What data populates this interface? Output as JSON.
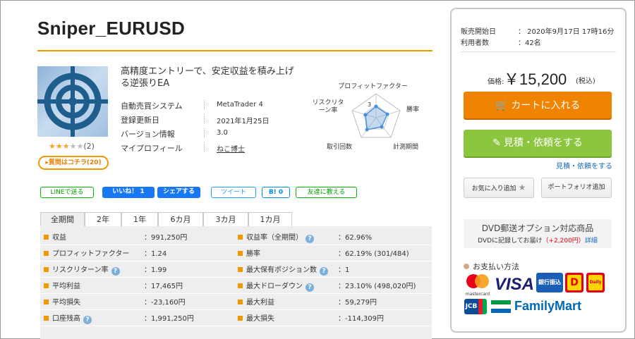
{
  "product": {
    "title": "Sniper_EURUSD",
    "tagline": "高精度エントリーで、安定収益を積み上げる逆張りEA",
    "rating_count": "(2)",
    "rating_value": 3,
    "rating_max": 5,
    "question_label": "▸質問はコチラ(20)"
  },
  "info": [
    {
      "label": "自動売買システム",
      "value": "MetaTrader 4"
    },
    {
      "label": "登録更新日",
      "value": "2021年1月25日"
    },
    {
      "label": "バージョン情報",
      "value": "3.0"
    },
    {
      "label": "マイプロフィール",
      "value": "ねこ博士"
    }
  ],
  "radar": {
    "labels": {
      "profit_factor": "プロフィットファクター",
      "win_rate": "勝率",
      "period": "計測期間",
      "trades": "取引回数",
      "risk_return": "リスクリターン率"
    },
    "center_number": "3"
  },
  "share": {
    "line": "LINEで送る",
    "like": "いいね！ 1",
    "fb_share": "シェアする",
    "tweet": "ツイート",
    "hatena": "B! 0",
    "friend": "友達に教える"
  },
  "tabs": [
    "全期間",
    "2年",
    "1年",
    "6カ月",
    "3カ月",
    "1カ月"
  ],
  "stats_left": [
    {
      "label": "収益",
      "value": "：991,250円",
      "help": false
    },
    {
      "label": "プロフィットファクター",
      "value": "：1.24",
      "help": false
    },
    {
      "label": "リスクリターン率",
      "value": "：1.99",
      "help": true
    },
    {
      "label": "平均利益",
      "value": "：17,465円",
      "help": false
    },
    {
      "label": "平均損失",
      "value": "：-23,160円",
      "help": false
    },
    {
      "label": "口座残高",
      "value": "：1,991,250円",
      "help": true
    }
  ],
  "stats_right": [
    {
      "label": "収益率（全期間）",
      "value": "：62.96%",
      "help": true
    },
    {
      "label": "勝率",
      "value": "：62.19% (301/484)",
      "help": false
    },
    {
      "label": "最大保有ポジション数",
      "value": "：1",
      "help": true
    },
    {
      "label": "最大ドローダウン",
      "value": "：23.10% (498,020円)",
      "help": true
    },
    {
      "label": "最大利益",
      "value": "：59,279円",
      "help": false
    },
    {
      "label": "最大損失",
      "value": "：-114,309円",
      "help": false
    }
  ],
  "side": {
    "sale_start_label": "販売開始日",
    "sale_start_value": "： 2020年9月17日 17時16分",
    "users_label": "利用者数",
    "users_value": "：42名",
    "price_label": "価格:",
    "price_value": "￥15,200",
    "price_tax": "(税込)",
    "cart_label": "カートに入れる",
    "quote_label": "見積・依頼をする",
    "quote_link": "見積・依頼をする",
    "favorite_label": "お気に入り追加",
    "portfolio_label": "ポートフォリオ追加",
    "dvd_title": "DVD郵送オプション対応商品",
    "dvd_sub_prefix": "DVDに記録してお届け",
    "dvd_sub_price": "（+2,200円）",
    "dvd_sub_detail": "詳細",
    "pay_title": "お支払い方法",
    "pay": {
      "mastercard": "mastercard",
      "visa": "VISA",
      "bank": "銀行振込",
      "jcb": "JCB",
      "familymart": "FamilyMart",
      "daily": "Daily"
    }
  },
  "colors": {
    "accent": "#f39800",
    "cart": "#f08300",
    "quote": "#8cc63f",
    "link": "#1a6ab7"
  }
}
